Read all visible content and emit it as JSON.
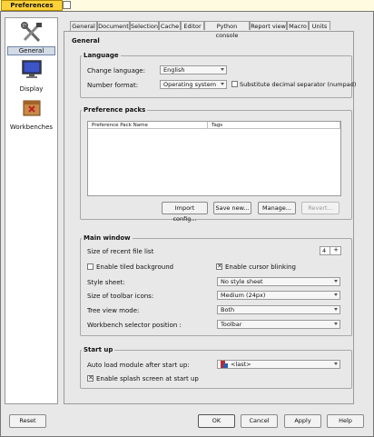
{
  "window": {
    "title": "Preferences"
  },
  "sidebar": {
    "items": [
      {
        "label": "General",
        "icon": "tools-icon",
        "selected": true
      },
      {
        "label": "Display",
        "icon": "monitor-icon",
        "selected": false
      },
      {
        "label": "Workbenches",
        "icon": "package-icon",
        "selected": false
      }
    ]
  },
  "tabs": [
    "General",
    "Document",
    "Selection",
    "Cache",
    "Editor",
    "Python console",
    "Report view",
    "Macro",
    "Units"
  ],
  "panel": {
    "title": "General"
  },
  "language": {
    "group_title": "Language",
    "change_language_label": "Change language:",
    "change_language_value": "English",
    "number_format_label": "Number format:",
    "number_format_value": "Operating system",
    "substitute_decimal_label": "Substitute decimal separator (numpad)",
    "substitute_decimal_checked": false
  },
  "packs": {
    "group_title": "Preference packs",
    "col_name": "Preference Pack Name",
    "col_tags": "Tags",
    "import_button": "Import config...",
    "save_button": "Save new...",
    "manage_button": "Manage...",
    "revert_button": "Revert..."
  },
  "main_window": {
    "group_title": "Main window",
    "recent_files_label": "Size of recent file list",
    "recent_files_value": "4",
    "tiled_bg_label": "Enable tiled background",
    "tiled_bg_checked": false,
    "cursor_blink_label": "Enable cursor blinking",
    "cursor_blink_checked": true,
    "style_sheet_label": "Style sheet:",
    "style_sheet_value": "No style sheet",
    "toolbar_icons_label": "Size of toolbar icons:",
    "toolbar_icons_value": "Medium (24px)",
    "tree_view_label": "Tree view mode:",
    "tree_view_value": "Both",
    "wb_selector_label": "Workbench selector position :",
    "wb_selector_value": "Toolbar"
  },
  "startup": {
    "group_title": "Start up",
    "auto_load_label": "Auto load module after start up:",
    "auto_load_value": "<last>",
    "splash_label": "Enable splash screen at start up",
    "splash_checked": true
  },
  "footer": {
    "reset_button": "Reset",
    "ok_button": "OK",
    "cancel_button": "Cancel",
    "apply_button": "Apply",
    "help_button": "Help"
  }
}
